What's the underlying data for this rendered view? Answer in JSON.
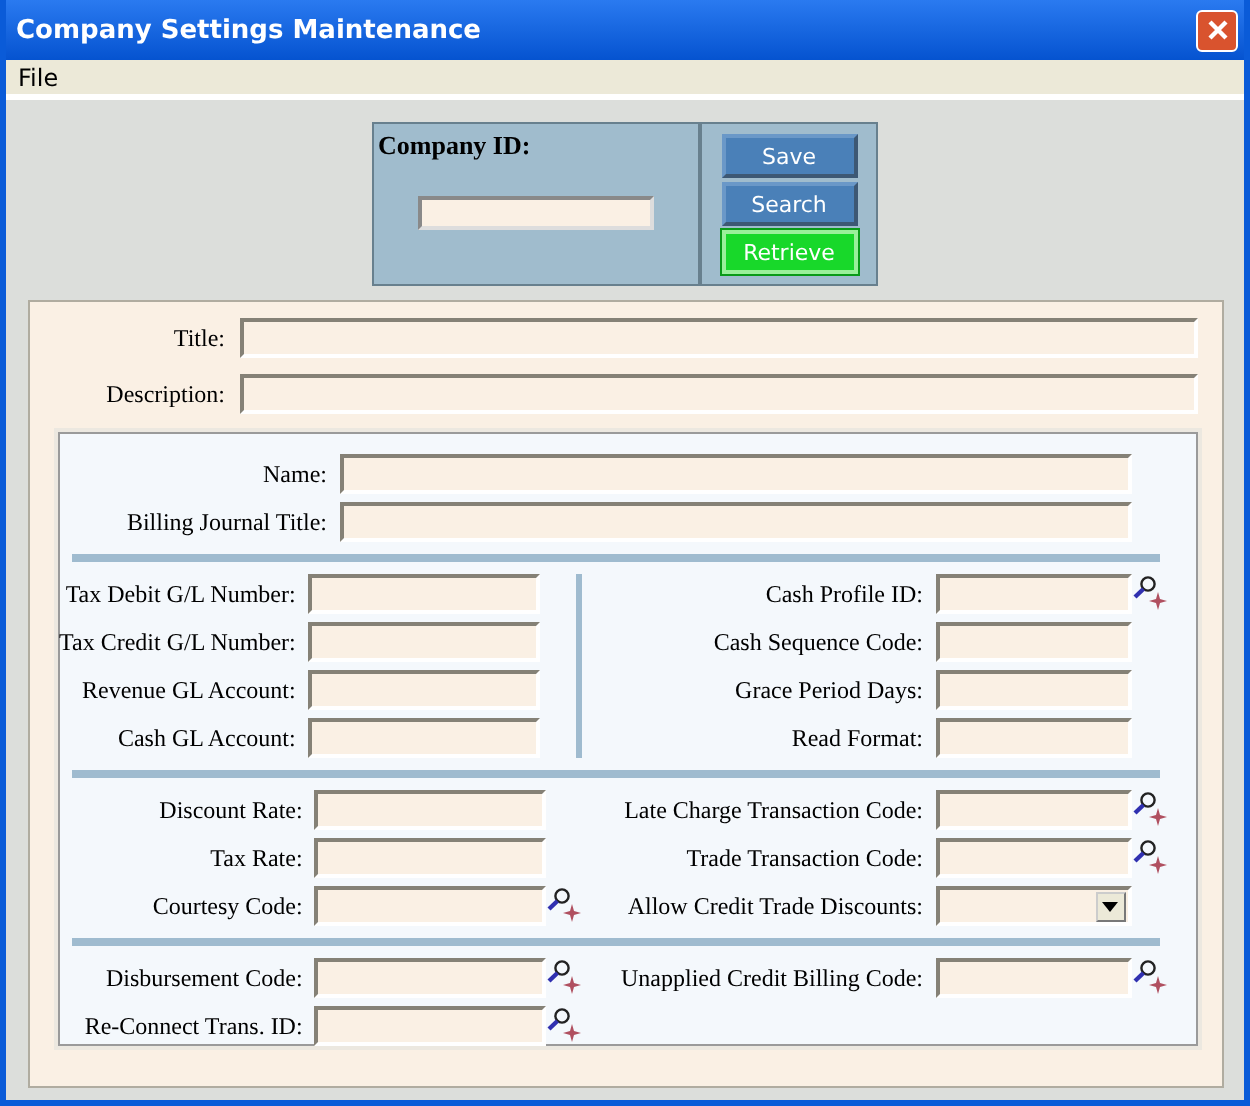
{
  "window": {
    "title": "Company Settings Maintenance"
  },
  "menu": [
    {
      "label": "File"
    }
  ],
  "company": {
    "label": "Company ID:"
  },
  "buttons": [
    {
      "label": "Save",
      "kind": "normal"
    },
    {
      "label": "Search",
      "kind": "normal"
    },
    {
      "label": "Retrieve",
      "kind": "accent"
    }
  ],
  "header_fields": [
    {
      "label": "Title:"
    },
    {
      "label": "Description:"
    }
  ],
  "sections": [
    {
      "kind": "full",
      "left": [
        {
          "label": "Name:",
          "kind": "text",
          "lookup": false
        },
        {
          "label": "Billing Journal Title:",
          "kind": "text",
          "lookup": false
        }
      ]
    },
    {
      "kind": "split",
      "left": [
        {
          "label": "Tax Debit G/L Number:",
          "kind": "text",
          "lookup": false
        },
        {
          "label": "Tax Credit G/L Number:",
          "kind": "text",
          "lookup": false
        },
        {
          "label": "Revenue GL Account:",
          "kind": "text",
          "lookup": false
        },
        {
          "label": "Cash GL Account:",
          "kind": "text",
          "lookup": false
        }
      ],
      "right": [
        {
          "label": "Cash Profile ID:",
          "kind": "text",
          "lookup": true
        },
        {
          "label": "Cash Sequence Code:",
          "kind": "text",
          "lookup": false
        },
        {
          "label": "Grace Period Days:",
          "kind": "text",
          "lookup": false
        },
        {
          "label": "Read Format:",
          "kind": "text",
          "lookup": false
        }
      ]
    },
    {
      "kind": "columns",
      "left": [
        {
          "label": "Discount Rate:",
          "kind": "text",
          "lookup": false
        },
        {
          "label": "Tax Rate:",
          "kind": "text",
          "lookup": false
        },
        {
          "label": "Courtesy Code:",
          "kind": "text",
          "lookup": true
        }
      ],
      "right": [
        {
          "label": "Late Charge Transaction Code:",
          "kind": "text",
          "lookup": true
        },
        {
          "label": "Trade Transaction Code:",
          "kind": "text",
          "lookup": true
        },
        {
          "label": "Allow Credit Trade Discounts:",
          "kind": "dropdown",
          "lookup": false
        }
      ]
    },
    {
      "kind": "columns",
      "left": [
        {
          "label": "Disbursement Code:",
          "kind": "text",
          "lookup": true
        },
        {
          "label": "Re-Connect Trans. ID:",
          "kind": "text",
          "lookup": true
        }
      ],
      "right": [
        {
          "label": "Unapplied Credit Billing Code:",
          "kind": "text",
          "lookup": true
        }
      ]
    }
  ]
}
